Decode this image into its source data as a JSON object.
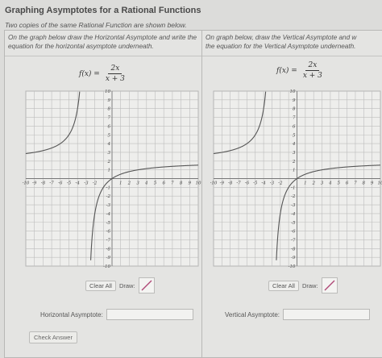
{
  "page": {
    "title": "Graphing Asymptotes for a Rational Functions",
    "subtitle": "Two copies of the same Rational Function are shown below."
  },
  "left_panel": {
    "instructions": "On the graph below draw the Horizontal Asymptote and write the equation for the horizontal asymptote underneath.",
    "formula_lhs": "f(x) =",
    "formula_num": "2x",
    "formula_den": "x + 3",
    "clear_label": "Clear All",
    "draw_label": "Draw:",
    "answer_label": "Horizontal Asymptote:",
    "answer_value": ""
  },
  "right_panel": {
    "instructions": "On graph below, draw the Vertical Asymptote and w",
    "instructions_line2": "the equation for the Vertical Asymptote underneath.",
    "formula_lhs": "f(x) =",
    "formula_num": "2x",
    "formula_den": "x + 3",
    "clear_label": "Clear All",
    "draw_label": "Draw:",
    "answer_label": "Vertical Asymptote:",
    "answer_value": ""
  },
  "check_button": "Check Answer",
  "graph": {
    "xlim": [
      -10,
      10
    ],
    "ylim": [
      -10,
      10
    ],
    "x_ticks": [
      -10,
      -9,
      -8,
      -7,
      -6,
      -5,
      -4,
      -3,
      -2,
      1,
      2,
      3,
      4,
      5,
      6,
      7,
      8,
      9,
      10
    ],
    "y_ticks": [
      10,
      9,
      8,
      7,
      6,
      5,
      4,
      3,
      2,
      1,
      -1,
      -2,
      -3,
      -4,
      -5,
      -6,
      -7,
      -8,
      -9,
      -10
    ],
    "curve_color": "#555555",
    "grid_color": "#bdbdbd"
  },
  "chart_data": {
    "type": "line",
    "title": "",
    "xlabel": "",
    "ylabel": "",
    "xlim": [
      -10,
      10
    ],
    "ylim": [
      -10,
      10
    ],
    "grid": true,
    "series": [
      {
        "function": "2x/(x+3)"
      }
    ]
  }
}
